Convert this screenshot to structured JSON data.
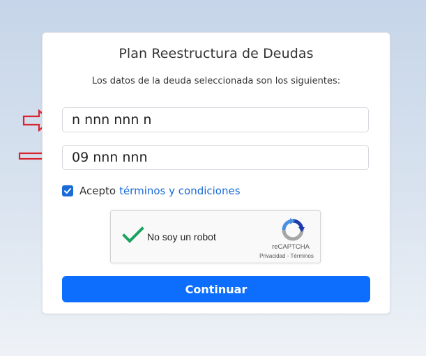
{
  "card": {
    "title": "Plan Reestructura de Deudas",
    "subtitle": "Los datos de la deuda seleccionada son los siguientes:"
  },
  "fields": [
    {
      "value": "n nnn nnn n"
    },
    {
      "value": "09 nnn nnn"
    }
  ],
  "terms": {
    "checked": true,
    "prefix": "Acepto",
    "link": "términos y condiciones"
  },
  "recaptcha": {
    "label": "No soy un robot",
    "brand": "reCAPTCHA",
    "privacy": "Privacidad",
    "separator": "-",
    "terms": "Términos"
  },
  "submit": {
    "label": "Continuar"
  },
  "annotations": {
    "arrow_color": "#d9232e",
    "arrows": [
      "arrow-right-icon",
      "arrow-right-icon",
      "arrow-up-icon"
    ]
  }
}
